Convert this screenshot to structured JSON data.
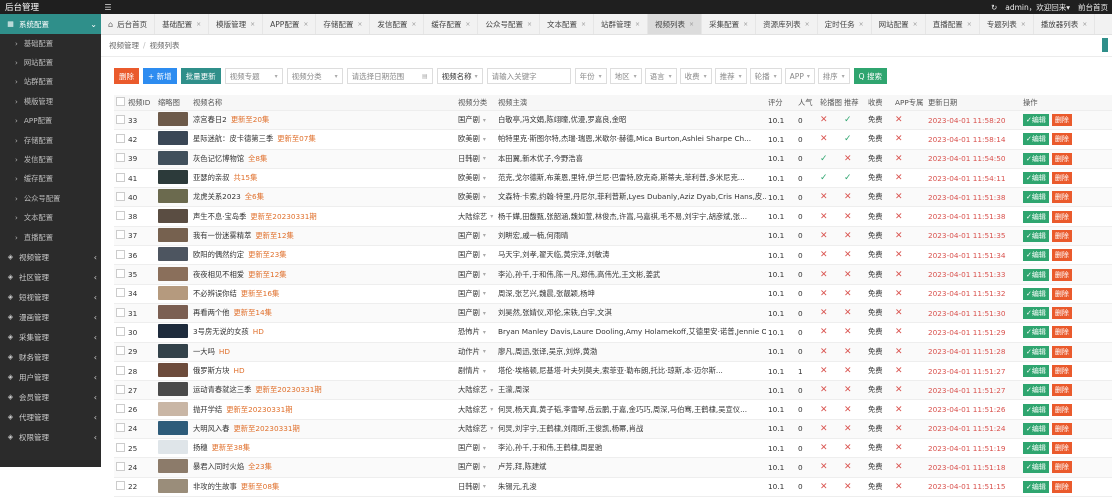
{
  "app": {
    "title": "后台管理",
    "menu_icon": "☰",
    "refresh_icon": "↻",
    "user": "admin，欢迎回来",
    "user_caret": "▾",
    "home_link": "前台首页"
  },
  "sidebar": {
    "active": {
      "label": "系统配置",
      "icon": "grid-icon"
    },
    "sub_items": [
      "基础配置",
      "网站配置",
      "站群配置",
      "模版管理",
      "APP配置",
      "存储配置",
      "发信配置",
      "缓存配置",
      "公众号配置",
      "文本配置",
      "直播配置"
    ],
    "groups": [
      "视频管理",
      "社区管理",
      "短视管理",
      "漫画管理",
      "采集管理",
      "财务管理",
      "用户管理",
      "会员管理",
      "代理管理",
      "权限管理"
    ]
  },
  "tabs": [
    {
      "label": "后台首页",
      "home": true
    },
    {
      "label": "基础配置"
    },
    {
      "label": "模版管理"
    },
    {
      "label": "APP配置"
    },
    {
      "label": "存储配置"
    },
    {
      "label": "发信配置"
    },
    {
      "label": "缓存配置"
    },
    {
      "label": "公众号配置"
    },
    {
      "label": "文本配置"
    },
    {
      "label": "站群管理"
    },
    {
      "label": "视频列表",
      "active": true
    },
    {
      "label": "采集配置"
    },
    {
      "label": "资源库列表"
    },
    {
      "label": "定时任务"
    },
    {
      "label": "网站配置"
    },
    {
      "label": "直播配置"
    },
    {
      "label": "专题列表"
    },
    {
      "label": "播放器列表"
    }
  ],
  "breadcrumb": [
    "视频管理",
    "视频列表"
  ],
  "toolbar": {
    "delete_label": "删除",
    "add_label": "+ 新增",
    "batch_label": "批量更新",
    "filters": [
      "视频专题",
      "视频分类",
      "请选择日期范围"
    ],
    "field_select": "视频名称",
    "keyword_placeholder": "请输入关键字",
    "more_filters": [
      "年份",
      "地区",
      "语言",
      "收费",
      "推荐",
      "轮播",
      "APP",
      "排序"
    ],
    "search_label": "Q 搜索"
  },
  "table": {
    "headers": [
      "视频ID",
      "缩略图",
      "视频名称",
      "视频分类",
      "视频主演",
      "评分",
      "人气",
      "轮播图",
      "推荐",
      "收费",
      "APP专属",
      "更新日期",
      "操作"
    ],
    "edit_label": "✓编辑",
    "delete_label": "删除",
    "rows": [
      {
        "id": "33",
        "name": "凉宫春日2",
        "upd": "更新至20集",
        "cat": "国产剧",
        "actors": "白敬亭,冯文娟,陈翊曈,优漫,罗嘉良,金昭",
        "score": "10.1",
        "pop": "0",
        "carousel": false,
        "rec": true,
        "fee": "免费",
        "app": false,
        "date": "2023-04-01 11:58:20",
        "thumb": "#6d5a4a"
      },
      {
        "id": "42",
        "name": "星际迷航：皮卡德第三季",
        "upd": "更新至07集",
        "cat": "欧美剧",
        "actors": "帕特里克·斯图尔特,杰瑞·瑞恩,米歇尔·赫德,Mica Burton,Ashlei Sharpe Ch...",
        "score": "10.1",
        "pop": "0",
        "carousel": false,
        "rec": true,
        "fee": "免费",
        "app": false,
        "date": "2023-04-01 11:58:14",
        "thumb": "#3a4756"
      },
      {
        "id": "39",
        "name": "灰色记忆博物馆",
        "upd": "全8集",
        "cat": "日韩剧",
        "actors": "本田翼,新木优子,今野浩喜",
        "score": "10.1",
        "pop": "0",
        "carousel": true,
        "rec": false,
        "fee": "免费",
        "app": false,
        "date": "2023-04-01 11:54:50",
        "thumb": "#41505c"
      },
      {
        "id": "41",
        "name": "亚瑟的亲叔",
        "upd": "共15集",
        "cat": "欧美剧",
        "actors": "范克,戈尔德斯,布莱恩,里特,伊兰尼·巴雷特,欧克奇,斯蒂夫,菲利普,多米尼克...",
        "score": "10.1",
        "pop": "0",
        "carousel": true,
        "rec": true,
        "fee": "免费",
        "app": false,
        "date": "2023-04-01 11:54:11",
        "thumb": "#2c3a3a"
      },
      {
        "id": "40",
        "name": "龙虎关系2023",
        "upd": "全6集",
        "cat": "欧美剧",
        "actors": "文森特·卡索,约翰·特里,丹尼尔,菲利普斯,Lyes Dubanly,Aziz Dyab,Cris Hans,皮...",
        "score": "10.1",
        "pop": "0",
        "carousel": false,
        "rec": false,
        "fee": "免费",
        "app": false,
        "date": "2023-04-01 11:51:38",
        "thumb": "#6b6a4e"
      },
      {
        "id": "38",
        "name": "声生不息·宝岛季",
        "upd": "更新至20230331期",
        "cat": "大陆综艺",
        "actors": "杨千嬅,田馥甄,张韶涵,魏如萱,林俊杰,许嵩,马嘉祺,毛不易,刘宇宁,胡彦斌,张...",
        "score": "10.1",
        "pop": "0",
        "carousel": false,
        "rec": false,
        "fee": "免费",
        "app": false,
        "date": "2023-04-01 11:51:38",
        "thumb": "#5a4d42"
      },
      {
        "id": "37",
        "name": "我有一份迷雾精萃",
        "upd": "更新至12集",
        "cat": "国产剧",
        "actors": "刘畊宏,戚一楠,何雨晴",
        "score": "10.1",
        "pop": "0",
        "carousel": false,
        "rec": false,
        "fee": "免费",
        "app": false,
        "date": "2023-04-01 11:51:35",
        "thumb": "#76614f"
      },
      {
        "id": "36",
        "name": "欧阳的偶然约定",
        "upd": "更新至23集",
        "cat": "国产剧",
        "actors": "马天宇,刘孝,翟天临,黄宗泽,刘敏涛",
        "score": "10.1",
        "pop": "0",
        "carousel": false,
        "rec": false,
        "fee": "免费",
        "app": false,
        "date": "2023-04-01 11:51:34",
        "thumb": "#4d5560"
      },
      {
        "id": "35",
        "name": "夜夜相见不相爱",
        "upd": "更新至12集",
        "cat": "国产剧",
        "actors": "李沁,孙千,于和伟,陈一凡,郑伟,高伟光,王文彬,姜武",
        "score": "10.1",
        "pop": "0",
        "carousel": false,
        "rec": false,
        "fee": "免费",
        "app": false,
        "date": "2023-04-01 11:51:33",
        "thumb": "#8a6f5b"
      },
      {
        "id": "34",
        "name": "不必辨误你结",
        "upd": "更新至16集",
        "cat": "国产剧",
        "actors": "周深,张艺兴,魏晨,张靓颖,杨坤",
        "score": "10.1",
        "pop": "0",
        "carousel": false,
        "rec": false,
        "fee": "免费",
        "app": false,
        "date": "2023-04-01 11:51:32",
        "thumb": "#b59a7e"
      },
      {
        "id": "31",
        "name": "再看两个他",
        "upd": "更新至14集",
        "cat": "国产剧",
        "actors": "刘昊然,张婧仪,邓伦,宋轶,白宇,文淇",
        "score": "10.1",
        "pop": "0",
        "carousel": false,
        "rec": false,
        "fee": "免费",
        "app": false,
        "date": "2023-04-01 11:51:30",
        "thumb": "#7b5f52"
      },
      {
        "id": "30",
        "name": "3号房无说的女孩",
        "upd": "HD",
        "cat": "恐怖片",
        "actors": "Bryan Manley Davis,Laure Dooling,Amy Holamekoff,艾德里安·诺普,Jennie Ost...",
        "score": "10.1",
        "pop": "0",
        "carousel": false,
        "rec": false,
        "fee": "免费",
        "app": false,
        "date": "2023-04-01 11:51:29",
        "thumb": "#1e2b3c"
      },
      {
        "id": "29",
        "name": "一大吗",
        "upd": "HD",
        "cat": "动作片",
        "actors": "廖凡,周迅,张译,吴京,刘烨,黄渤",
        "score": "10.1",
        "pop": "0",
        "carousel": false,
        "rec": false,
        "fee": "免费",
        "app": false,
        "date": "2023-04-01 11:51:28",
        "thumb": "#33424a"
      },
      {
        "id": "28",
        "name": "俄罗斯方块",
        "upd": "HD",
        "cat": "剧情片",
        "actors": "塔伦·埃格顿,尼基塔·叶夫列莫夫,索菲亚·勒布朗,托比·琼斯,本·迈尔斯...",
        "score": "10.1",
        "pop": "1",
        "carousel": false,
        "rec": false,
        "fee": "免费",
        "app": false,
        "date": "2023-04-01 11:51:27",
        "thumb": "#6d4c3c"
      },
      {
        "id": "27",
        "name": "运动青春就这三季",
        "upd": "更新至20230331期",
        "cat": "大陆综艺",
        "actors": "王濛,周深",
        "score": "10.1",
        "pop": "0",
        "carousel": false,
        "rec": false,
        "fee": "免费",
        "app": false,
        "date": "2023-04-01 11:51:27",
        "thumb": "#4a4a4a"
      },
      {
        "id": "26",
        "name": "抛开学结",
        "upd": "更新至20230331期",
        "cat": "大陆综艺",
        "actors": "何炅,杨天真,黄子韬,李雪琴,岳云鹏,于嘉,金巧巧,周深,马伯骞,王鹤棣,吴宣仪...",
        "score": "10.1",
        "pop": "0",
        "carousel": false,
        "rec": false,
        "fee": "免费",
        "app": false,
        "date": "2023-04-01 11:51:26",
        "thumb": "#c9b6a5"
      },
      {
        "id": "24",
        "name": "大明风入春",
        "upd": "更新至20230331期",
        "cat": "大陆综艺",
        "actors": "何炅,刘宇宁,王鹤棣,刘雨昕,王俊凯,杨幂,肖战",
        "score": "10.1",
        "pop": "0",
        "carousel": false,
        "rec": false,
        "fee": "免费",
        "app": false,
        "date": "2023-04-01 11:51:24",
        "thumb": "#2e5c7a"
      },
      {
        "id": "25",
        "name": "扬穗",
        "upd": "更新至38集",
        "cat": "国产剧",
        "actors": "李沁,孙千,于和伟,王鹤棣,周星驰",
        "score": "10.1",
        "pop": "0",
        "carousel": false,
        "rec": false,
        "fee": "免费",
        "app": false,
        "date": "2023-04-01 11:51:19",
        "thumb": "#dfe5e9"
      },
      {
        "id": "24",
        "name": "暴君入同时火焰",
        "upd": "全23集",
        "cat": "国产剧",
        "actors": "卢芳,拜,陈建斌",
        "score": "10.1",
        "pop": "0",
        "carousel": false,
        "rec": false,
        "fee": "免费",
        "app": false,
        "date": "2023-04-01 11:51:18",
        "thumb": "#8c7b6a"
      },
      {
        "id": "22",
        "name": "非攻的生故事",
        "upd": "更新至08集",
        "cat": "日韩剧",
        "actors": "朱锡元,孔浚",
        "score": "10.1",
        "pop": "0",
        "carousel": false,
        "rec": false,
        "fee": "免费",
        "app": false,
        "date": "2023-04-01 11:51:15",
        "thumb": "#9a8d7a"
      }
    ]
  }
}
